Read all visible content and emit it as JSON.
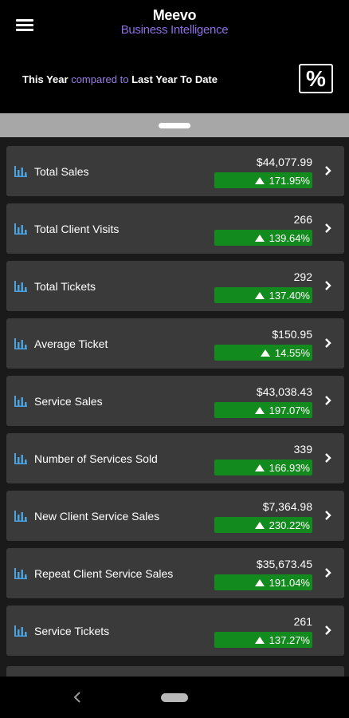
{
  "header": {
    "menu_icon": "hamburger-menu-icon",
    "brand": "Meevo",
    "subtitle": "Business Intelligence",
    "compare": {
      "period": "This Year",
      "connector": "compared to",
      "baseline": "Last Year To Date"
    },
    "percent_toggle": "%"
  },
  "colors": {
    "accent": "#8c6fe0",
    "positive": "#138a1d",
    "row_bg": "#3a3a3a",
    "icon_blue": "#4aa3df"
  },
  "metrics": [
    {
      "label": "Total Sales",
      "value": "$44,077.99",
      "change": "171.95%",
      "direction": "up"
    },
    {
      "label": "Total Client Visits",
      "value": "266",
      "change": "139.64%",
      "direction": "up"
    },
    {
      "label": "Total Tickets",
      "value": "292",
      "change": "137.40%",
      "direction": "up"
    },
    {
      "label": "Average Ticket",
      "value": "$150.95",
      "change": "14.55%",
      "direction": "up"
    },
    {
      "label": "Service Sales",
      "value": "$43,038.43",
      "change": "197.07%",
      "direction": "up"
    },
    {
      "label": "Number of Services Sold",
      "value": "339",
      "change": "166.93%",
      "direction": "up"
    },
    {
      "label": "New Client Service Sales",
      "value": "$7,364.98",
      "change": "230.22%",
      "direction": "up"
    },
    {
      "label": "Repeat Client Service Sales",
      "value": "$35,673.45",
      "change": "191.04%",
      "direction": "up"
    },
    {
      "label": "Service Tickets",
      "value": "261",
      "change": "137.27%",
      "direction": "up"
    }
  ],
  "navbar": {
    "back_icon": "back-chevron-icon",
    "home_icon": "home-pill-icon"
  }
}
